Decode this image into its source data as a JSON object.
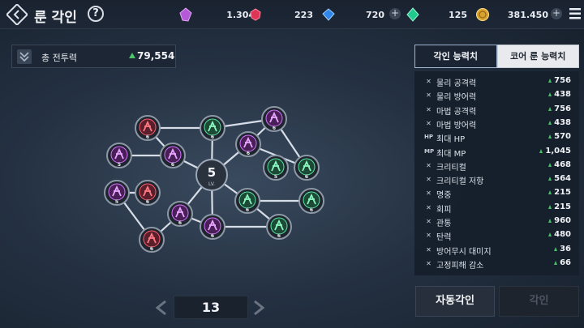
{
  "header": {
    "title": "룬 각인",
    "help_label": "?",
    "currencies": [
      {
        "icon": "purple-crystal-icon",
        "amount": "1.304",
        "color": "#c46be0"
      },
      {
        "icon": "red-gem-icon",
        "amount": "223",
        "color": "#e0395a"
      },
      {
        "icon": "blue-diamond-icon",
        "amount": "720",
        "color": "#3a8ff0"
      },
      {
        "icon": "green-gem-icon",
        "amount": "125",
        "color": "#2fd49a"
      },
      {
        "icon": "gold-coin-icon",
        "amount": "381.450",
        "color": "#e6b43a"
      }
    ],
    "plus_label": "+"
  },
  "power": {
    "label": "총 전투력",
    "value": "79,554"
  },
  "graph": {
    "center_level": "5",
    "center_sub": "LV.",
    "nodes": [
      {
        "id": "n1",
        "type": "red",
        "level": "6"
      },
      {
        "id": "n2",
        "type": "green",
        "level": "6"
      },
      {
        "id": "n3",
        "type": "purple",
        "level": "6"
      },
      {
        "id": "n4",
        "type": "purple",
        "level": "5"
      },
      {
        "id": "n5",
        "type": "purple",
        "level": "6"
      },
      {
        "id": "n6",
        "type": "purple",
        "level": "6"
      },
      {
        "id": "n7",
        "type": "green",
        "level": "5"
      },
      {
        "id": "n8",
        "type": "green",
        "level": "6"
      },
      {
        "id": "n9",
        "type": "purple",
        "level": "5"
      },
      {
        "id": "n10",
        "type": "red",
        "level": "6"
      },
      {
        "id": "n11",
        "type": "green",
        "level": "6"
      },
      {
        "id": "n12",
        "type": "green",
        "level": "6"
      },
      {
        "id": "n13",
        "type": "purple",
        "level": "6"
      },
      {
        "id": "n14",
        "type": "purple",
        "level": "6"
      },
      {
        "id": "n15",
        "type": "green",
        "level": "6"
      },
      {
        "id": "n16",
        "type": "red",
        "level": "6"
      }
    ]
  },
  "pager": {
    "value": "13"
  },
  "tabs": [
    {
      "label": "각인 능력치",
      "active": true
    },
    {
      "label": "코어 룬 능력치",
      "active": false
    }
  ],
  "stats": [
    {
      "icon": "crossed-swords-icon",
      "name": "물리 공격력",
      "value": "756"
    },
    {
      "icon": "shield-icon",
      "name": "물리 방어력",
      "value": "438"
    },
    {
      "icon": "magic-staff-icon",
      "name": "마법 공격력",
      "value": "756"
    },
    {
      "icon": "magic-shield-icon",
      "name": "마법 방어력",
      "value": "438"
    },
    {
      "icon": "hp-icon",
      "icon_text": "HP",
      "name": "최대 HP",
      "value": "570"
    },
    {
      "icon": "mp-icon",
      "icon_text": "MP",
      "name": "최대 MP",
      "value": "1,045"
    },
    {
      "icon": "crossed-swords-icon",
      "name": "크리티컬",
      "value": "468"
    },
    {
      "icon": "crossed-swords-icon",
      "name": "크리티컬 저항",
      "value": "564"
    },
    {
      "icon": "crossed-swords-icon",
      "name": "명중",
      "value": "215"
    },
    {
      "icon": "crossed-swords-icon",
      "name": "회피",
      "value": "215"
    },
    {
      "icon": "crossed-swords-icon",
      "name": "관통",
      "value": "960"
    },
    {
      "icon": "crossed-swords-icon",
      "name": "탄력",
      "value": "480"
    },
    {
      "icon": "crossed-swords-icon",
      "name": "방어무시 대미지",
      "value": "36"
    },
    {
      "icon": "crossed-swords-icon",
      "name": "고정피해 감소",
      "value": "66"
    }
  ],
  "buttons": {
    "auto": "자동각인",
    "engrave": "각인"
  }
}
